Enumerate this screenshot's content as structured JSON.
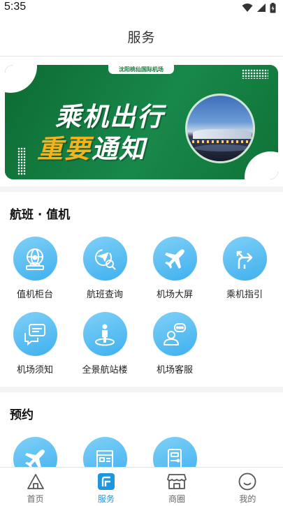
{
  "status_bar": {
    "time": "5:35"
  },
  "header": {
    "title": "服务"
  },
  "banner": {
    "tag": "沈阳桃仙国际机场",
    "line1": "乘机出行",
    "line2_highlight": "重要",
    "line2_rest": "通知"
  },
  "sections": {
    "flight": {
      "title": "航班 · 值机",
      "items": [
        {
          "label": "值机柜台",
          "icon": "counter-globe-icon"
        },
        {
          "label": "航班查询",
          "icon": "flight-search-icon"
        },
        {
          "label": "机场大屏",
          "icon": "airplane-icon"
        },
        {
          "label": "乘机指引",
          "icon": "direction-arrows-icon"
        },
        {
          "label": "机场须知",
          "icon": "chat-bubbles-icon"
        },
        {
          "label": "全景航站楼",
          "icon": "panorama-person-icon"
        },
        {
          "label": "机场客服",
          "icon": "customer-service-icon"
        }
      ]
    },
    "booking": {
      "title": "预约",
      "items": [
        {
          "icon": "airplane-icon"
        },
        {
          "icon": "document-icon"
        },
        {
          "icon": "door-lock-icon"
        }
      ]
    }
  },
  "tabbar": {
    "items": [
      {
        "label": "首页",
        "icon": "home-icon",
        "active": false
      },
      {
        "label": "服务",
        "icon": "service-icon",
        "active": true
      },
      {
        "label": "商圈",
        "icon": "shop-icon",
        "active": false
      },
      {
        "label": "我的",
        "icon": "smile-icon",
        "active": false
      }
    ]
  },
  "colors": {
    "accent": "#1c97df",
    "icon_bg": "#4fbaf1",
    "banner_green": "#1b7a3c",
    "banner_highlight": "#f5b21a"
  }
}
